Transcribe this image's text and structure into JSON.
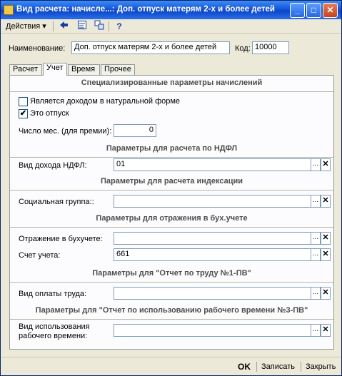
{
  "window": {
    "title": "Вид расчета: начисле...: Доп. отпуск матерям 2-х и более детей",
    "min_label": "_",
    "max_label": "□",
    "close_label": "✕"
  },
  "toolbar": {
    "actions_label": "Действия",
    "dropdown_arrow": "▾",
    "help_label": "?"
  },
  "header": {
    "name_label": "Наименование:",
    "name_value": "Доп. отпуск матерям 2-х и более детей",
    "code_label": "Код:",
    "code_value": "10000"
  },
  "tabs": [
    {
      "label": "Расчет"
    },
    {
      "label": "Учет",
      "active": true
    },
    {
      "label": "Время"
    },
    {
      "label": "Прочее"
    }
  ],
  "sections": {
    "special": "Специализированные параметры начислений",
    "ndfl": "Параметры для расчета по НДФЛ",
    "indexation": "Параметры для расчета индексации",
    "accounting": "Параметры для отражения в бух.учете",
    "labor_report": "Параметры для \"Отчет по труду №1-ПВ\"",
    "time_report": "Параметры для \"Отчет по использованию рабочего времени №3-ПВ\""
  },
  "fields": {
    "natural_income": {
      "label": "Является доходом в натуральной форме",
      "checked": false
    },
    "is_vacation": {
      "label": "Это отпуск",
      "checked": true,
      "mark": "✔"
    },
    "months_label": "Число мес. (для премии):",
    "months_value": "0",
    "ndfl_income_label": "Вид дохода НДФЛ:",
    "ndfl_income_value": "01",
    "social_group_label": "Социальная группа::",
    "social_group_value": "",
    "accounting_reflection_label": "Отражение в бухучете:",
    "accounting_reflection_value": "",
    "account_label": "Счет учета:",
    "account_value": "661",
    "payment_type_label": "Вид оплаты труда:",
    "payment_type_value": "",
    "time_usage_label_1": "Вид использования",
    "time_usage_label_2": "рабочего времени:",
    "time_usage_value": ""
  },
  "field_buttons": {
    "select": "...",
    "clear": "✕"
  },
  "footer": {
    "ok": "OK",
    "save": "Записать",
    "close": "Закрыть"
  }
}
